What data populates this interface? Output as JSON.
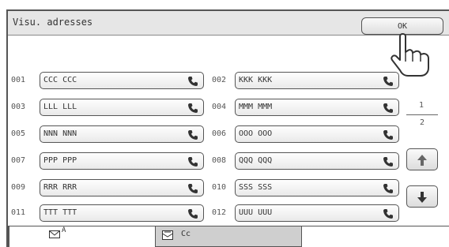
{
  "header": {
    "title": "Visu. adresses",
    "ok_label": "OK"
  },
  "addresses": [
    {
      "num": "001",
      "name": "CCC CCC"
    },
    {
      "num": "002",
      "name": "KKK KKK"
    },
    {
      "num": "003",
      "name": "LLL LLL"
    },
    {
      "num": "004",
      "name": "MMM MMM"
    },
    {
      "num": "005",
      "name": "NNN NNN"
    },
    {
      "num": "006",
      "name": "OOO OOO"
    },
    {
      "num": "007",
      "name": "PPP PPP"
    },
    {
      "num": "008",
      "name": "QQQ QQQ"
    },
    {
      "num": "009",
      "name": "RRR RRR"
    },
    {
      "num": "010",
      "name": "SSS SSS"
    },
    {
      "num": "011",
      "name": "TTT TTT"
    },
    {
      "num": "012",
      "name": "UUU UUU"
    }
  ],
  "pagination": {
    "current": "1",
    "total": "2"
  },
  "tabs": {
    "to_label": "A",
    "cc_label": "Cc"
  },
  "icons": {
    "phone": "phone-icon",
    "up": "arrow-up-icon",
    "down": "arrow-down-icon",
    "hand": "pointing-hand-icon",
    "envelope": "envelope-icon"
  }
}
